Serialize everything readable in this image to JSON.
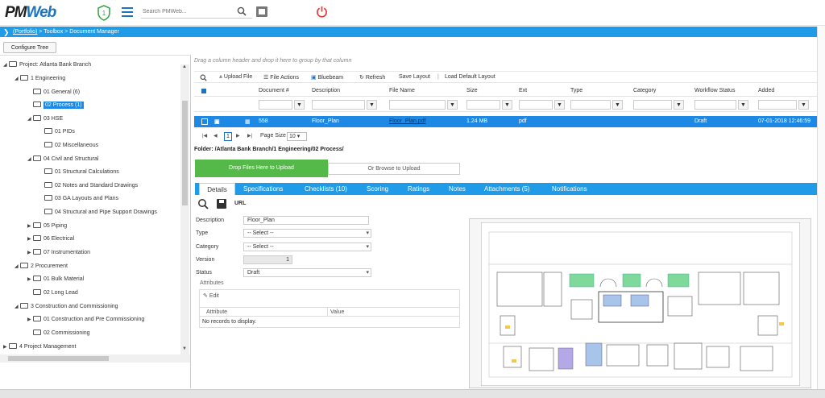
{
  "header": {
    "logo_pm": "PM",
    "logo_web": "Web",
    "badge_count": "1",
    "search_placeholder": "Search PMWeb...",
    "brand_color": "#1e73be"
  },
  "breadcrumb": {
    "root": "(Portfolio)",
    "rest": " > Toolbox > Document Manager"
  },
  "tree": {
    "configure_label": "Configure Tree",
    "items": [
      {
        "label": "Project: Atlanta Bank Branch"
      },
      {
        "label": "1 Engineering"
      },
      {
        "label": "01 General (6)"
      },
      {
        "label": "02 Process (1)"
      },
      {
        "label": "03 HSE"
      },
      {
        "label": "01 PIDs"
      },
      {
        "label": "02 Miscellaneous"
      },
      {
        "label": "04 Civil and Structural"
      },
      {
        "label": "01 Structural Calculations"
      },
      {
        "label": "02 Notes and Standard Drawings"
      },
      {
        "label": "03 GA Layouts and Plans"
      },
      {
        "label": "04 Structural and Pipe Support Drawings"
      },
      {
        "label": "05 Piping"
      },
      {
        "label": "06 Electrical"
      },
      {
        "label": "07 Instrumentation"
      },
      {
        "label": "2 Procurement"
      },
      {
        "label": "01 Bulk Material"
      },
      {
        "label": "02 Long Lead"
      },
      {
        "label": "3 Construction and Commissioning"
      },
      {
        "label": "01 Construction and Pre Commissioning"
      },
      {
        "label": "02 Commissioning"
      },
      {
        "label": "4 Project Management"
      }
    ]
  },
  "grid": {
    "group_hint": "Drag a column header and drop it here to group by that column",
    "toolbar": {
      "upload": "Upload File",
      "file_actions": "File Actions",
      "bluebeam": "Bluebeam",
      "refresh": "Refresh",
      "save_layout": "Save Layout",
      "load_layout": "Load Default Layout"
    },
    "columns": {
      "document": "Document #",
      "description": "Description",
      "file_name": "File Name",
      "size": "Size",
      "ext": "Ext",
      "type": "Type",
      "category": "Category",
      "workflow": "Workflow Status",
      "added": "Added"
    },
    "row": {
      "document": "558",
      "description": "Floor_Plan",
      "file_name": "Floor_Plan.pdf",
      "size": "1.24 MB",
      "ext": "pdf",
      "workflow": "Draft",
      "added": "07-01-2018 12:46:59"
    },
    "pager": {
      "current_page": "1",
      "page_size_label": "Page Size",
      "page_size": "10"
    },
    "folder_path": "Folder: /Atlanta Bank Branch/1 Engineering/02 Process/",
    "drop_label": "Drop Files Here to Upload",
    "browse_label": "Or Browse to Upload",
    "drop_color": "#54b948"
  },
  "tabs": [
    {
      "label": "Details"
    },
    {
      "label": "Specifications"
    },
    {
      "label": "Checklists (10)"
    },
    {
      "label": "Scoring"
    },
    {
      "label": "Ratings"
    },
    {
      "label": "Notes"
    },
    {
      "label": "Attachments (5)"
    },
    {
      "label": "Notifications"
    }
  ],
  "details": {
    "url_label": "URL",
    "description_label": "Description",
    "description_value": "Floor_Plan",
    "type_label": "Type",
    "type_value": "-- Select --",
    "category_label": "Category",
    "category_value": "-- Select --",
    "version_label": "Version",
    "version_value": "1",
    "status_label": "Status",
    "status_value": "Draft",
    "attributes_title": "Attributes",
    "edit_label": "Edit",
    "attr_col": "Attribute",
    "value_col": "Value",
    "no_records": "No records to display."
  }
}
